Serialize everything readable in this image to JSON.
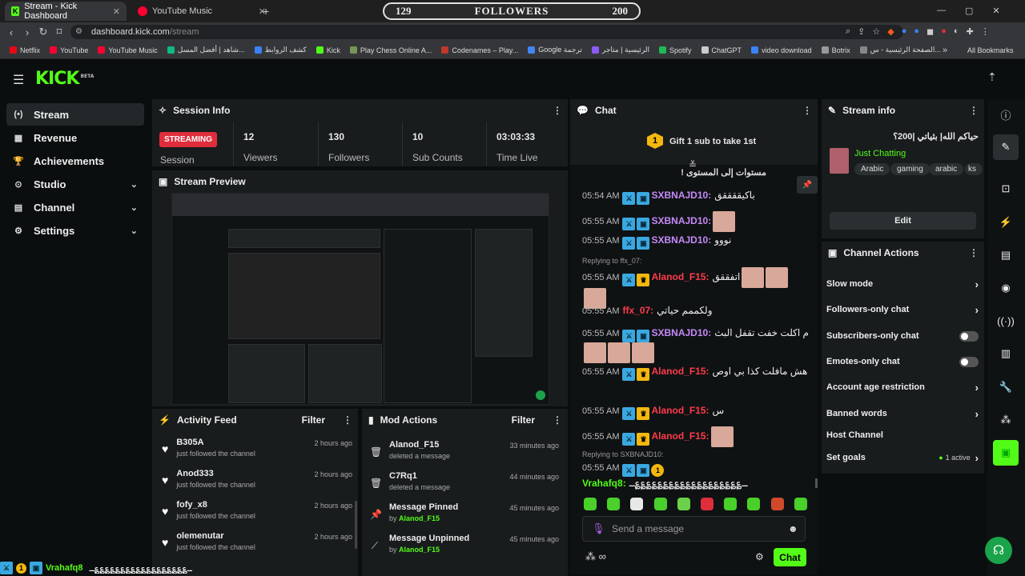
{
  "browser": {
    "tabs": [
      {
        "title": "Stream - Kick Dashboard",
        "active": true
      },
      {
        "title": "YouTube Music",
        "active": false
      }
    ],
    "new_tab": "+",
    "url_host": "dashboard.kick.com",
    "url_path": "/stream",
    "bookmarks": [
      {
        "label": "Netflix",
        "color": "#e50914"
      },
      {
        "label": "YouTube",
        "color": "#ff0033"
      },
      {
        "label": "YouTube Music",
        "color": "#ff0033"
      },
      {
        "label": "شاهد | أفضل المسل...",
        "color": "#10b981"
      },
      {
        "label": "كشف الروابط",
        "color": "#3b82f6"
      },
      {
        "label": "Kick",
        "color": "#53fc18"
      },
      {
        "label": "Play Chess Online A...",
        "color": "#769656"
      },
      {
        "label": "Codenames – Play...",
        "color": "#c0392b"
      },
      {
        "label": "Google ترجمة",
        "color": "#4285f4"
      },
      {
        "label": "الرئيسية | متاجر",
        "color": "#8b5cf6"
      },
      {
        "label": "Spotify",
        "color": "#1db954"
      },
      {
        "label": "ChatGPT",
        "color": "#cccccc"
      },
      {
        "label": "video download",
        "color": "#3b82f6"
      },
      {
        "label": "Botrix",
        "color": "#999999"
      },
      {
        "label": "الصفحة الرئيسية - س...",
        "color": "#888888"
      }
    ],
    "bookmarks_more": "»",
    "all_bookmarks": "All Bookmarks"
  },
  "follower_goal": {
    "current": "129",
    "label": "FOLLOWERS",
    "target": "200"
  },
  "kick": {
    "logo": "KICK",
    "logo_tag": "BETA",
    "sidebar": [
      {
        "label": "Stream",
        "icon": "broadcast-icon",
        "glyph": "(•)",
        "active": true,
        "expand": false
      },
      {
        "label": "Revenue",
        "icon": "revenue-icon",
        "glyph": "▦",
        "active": false,
        "expand": false
      },
      {
        "label": "Achievements",
        "icon": "trophy-icon",
        "glyph": "🏆",
        "active": false,
        "expand": false
      },
      {
        "label": "Studio",
        "icon": "studio-icon",
        "glyph": "⊙",
        "active": false,
        "expand": true
      },
      {
        "label": "Channel",
        "icon": "channel-icon",
        "glyph": "▤",
        "active": false,
        "expand": true
      },
      {
        "label": "Settings",
        "icon": "gear-icon",
        "glyph": "⚙",
        "active": false,
        "expand": true
      }
    ]
  },
  "session": {
    "title": "Session Info",
    "badge": "STREAMING",
    "badge_label": "Session",
    "stats": [
      {
        "value": "12",
        "label": "Viewers"
      },
      {
        "value": "130",
        "label": "Followers"
      },
      {
        "value": "10",
        "label": "Sub Counts"
      },
      {
        "value": "03:03:33",
        "label": "Time Live"
      }
    ]
  },
  "preview": {
    "title": "Stream Preview"
  },
  "activity": {
    "title": "Activity Feed",
    "filter": "Filter",
    "items": [
      {
        "name": "B305A",
        "sub": "just followed the channel",
        "time": "2 hours ago"
      },
      {
        "name": "Anod333",
        "sub": "just followed the channel",
        "time": "2 hours ago"
      },
      {
        "name": "fofy_x8",
        "sub": "just followed the channel",
        "time": "2 hours ago"
      },
      {
        "name": "olemenutar",
        "sub": "just followed the channel",
        "time": "2 hours ago"
      }
    ]
  },
  "mod": {
    "title": "Mod Actions",
    "filter": "Filter",
    "items": [
      {
        "name": "Alanod_F15",
        "sub_prefix": "deleted a message",
        "who": "",
        "time": "33 minutes ago",
        "icon": "trash-icon",
        "glyph": "🗑"
      },
      {
        "name": "C7Rq1",
        "sub_prefix": "deleted a message",
        "who": "",
        "time": "44 minutes ago",
        "icon": "trash-icon",
        "glyph": "🗑"
      },
      {
        "name": "Message Pinned",
        "sub_prefix": "by ",
        "who": "Alanod_F15",
        "time": "45 minutes ago",
        "icon": "pin-icon",
        "glyph": "📌"
      },
      {
        "name": "Message Unpinned",
        "sub_prefix": "by ",
        "who": "Alanod_F15",
        "time": "45 minutes ago",
        "icon": "unpin-icon",
        "glyph": "⟋"
      }
    ]
  },
  "chat": {
    "title": "Chat",
    "gift_rank": "1",
    "gift_text": "Gift 1 sub to take 1st",
    "pinned_text": "مستوات إلى المستوى !",
    "messages": [
      {
        "time": "05:54 AM",
        "badges": [
          "sw",
          "gk"
        ],
        "user": "SXBNAJD10",
        "ucls": "u-pur",
        "text": "باكيققققق",
        "img": 0,
        "reply": ""
      },
      {
        "time": "05:55 AM",
        "badges": [
          "sw",
          "gk"
        ],
        "user": "SXBNAJD10",
        "ucls": "u-pur",
        "text": "",
        "img": 1,
        "reply": ""
      },
      {
        "time": "05:55 AM",
        "badges": [
          "sw",
          "gk"
        ],
        "user": "SXBNAJD10",
        "ucls": "u-pur",
        "text": "نووو",
        "img": 0,
        "reply": ""
      },
      {
        "time": "05:55 AM",
        "badges": [
          "sw",
          "cr"
        ],
        "user": "Alanod_F15",
        "ucls": "u-red",
        "text": "اتفققق",
        "img": 3,
        "reply": "Replying to ffx_07:"
      },
      {
        "time": "05:55 AM",
        "badges": [],
        "user": "ffx_07",
        "ucls": "u-red",
        "text": "ولكممم حياتي",
        "img": 0,
        "reply": ""
      },
      {
        "time": "05:55 AM",
        "badges": [
          "sw",
          "gk"
        ],
        "user": "SXBNAJD10",
        "ucls": "u-pur",
        "text": "م اكلت خفت تقفل البث",
        "img": 3,
        "reply": ""
      },
      {
        "time": "05:55 AM",
        "badges": [
          "sw",
          "cr"
        ],
        "user": "Alanod_F15",
        "ucls": "u-red",
        "text": "هش مافلت كذا بي اوص",
        "img": 0,
        "reply": ""
      },
      {
        "time": "05:55 AM",
        "badges": [
          "sw",
          "cr"
        ],
        "user": "Alanod_F15",
        "ucls": "u-red",
        "text": "س",
        "img": 0,
        "reply": ""
      },
      {
        "time": "05:55 AM",
        "badges": [
          "sw",
          "cr"
        ],
        "user": "Alanod_F15",
        "ucls": "u-red",
        "text": "",
        "img": 1,
        "reply": ""
      },
      {
        "time": "05:55 AM",
        "badges": [
          "sw",
          "gk",
          "gold"
        ],
        "user": "Vrahafq8",
        "ucls": "u-grn",
        "text": "ـ؏؏؏؏؏؏؏؏؏؏؏؏؏؏؏؏؏؏؏ـ",
        "img": 0,
        "reply": "Replying to SXBNAJD10:"
      }
    ],
    "input_placeholder": "Send a message",
    "send": "Chat"
  },
  "stream_info": {
    "title": "Stream info",
    "stream_title": "حياكم الله| بثياتي |200؟",
    "category": "Just Chatting",
    "tags": [
      "Arabic",
      "gaming",
      "arabic",
      "ks"
    ],
    "edit": "Edit"
  },
  "channel_actions": {
    "title": "Channel Actions",
    "items": [
      {
        "label": "Slow mode",
        "control": "arrow"
      },
      {
        "label": "Followers-only chat",
        "control": "arrow"
      },
      {
        "label": "Subscribers-only chat",
        "control": "toggle"
      },
      {
        "label": "Emotes-only chat",
        "control": "toggle"
      },
      {
        "label": "Account age restriction",
        "control": "arrow"
      },
      {
        "label": "Banned words",
        "control": "arrow"
      },
      {
        "label": "Host Channel",
        "control": "none"
      },
      {
        "label": "Set goals",
        "control": "arrow"
      }
    ],
    "goals_status": "1 active"
  },
  "overlay": {
    "user": "Vrahafq8",
    "text": "ـ؏؏؏؏؏؏؏؏؏؏؏؏؏؏؏؏؏؏ـ"
  },
  "colors": {
    "accent": "#53fc18",
    "live": "#e02d3c",
    "panel": "#181c1d",
    "bg": "#0b0e0f"
  }
}
